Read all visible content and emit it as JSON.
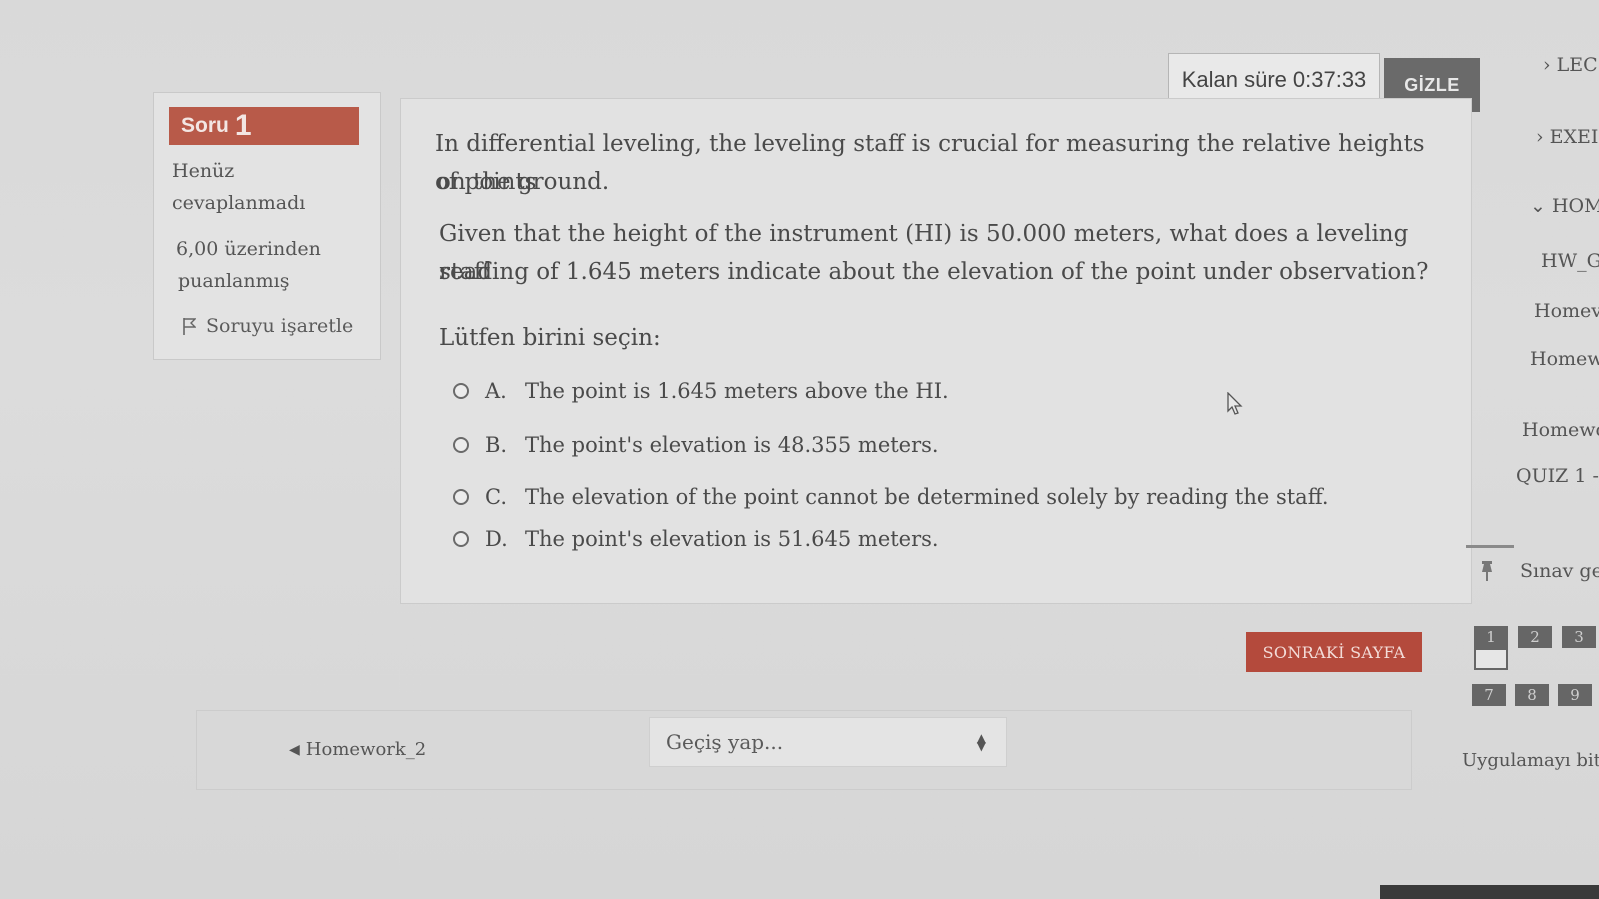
{
  "timer": {
    "label": "Kalan süre",
    "value": "0:37:33",
    "hide_button": "GİZLE"
  },
  "question_info": {
    "soru_label": "Soru",
    "number": "1",
    "status_line1": "Henüz",
    "status_line2": "cevaplanmadı",
    "points_line1": "6,00 üzerinden",
    "points_line2": "puanlanmış",
    "flag_label": "Soruyu işaretle"
  },
  "question": {
    "paragraph1_line1": "In differential leveling, the leveling staff is crucial for measuring the relative heights of points",
    "paragraph1_line2": "on the ground.",
    "paragraph2_line1": "Given that the height of the instrument (HI) is 50.000 meters, what does a leveling staff",
    "paragraph2_line2": "reading of 1.645 meters indicate about the elevation of the point under observation?",
    "prompt": "Lütfen birini seçin:",
    "options": [
      {
        "letter": "A.",
        "text": "The point is 1.645 meters above the HI."
      },
      {
        "letter": "B.",
        "text": "The point's elevation is 48.355 meters."
      },
      {
        "letter": "C.",
        "text": "The elevation of the point cannot be determined solely by reading the staff."
      },
      {
        "letter": "D.",
        "text": "The point's elevation is 51.645 meters."
      }
    ]
  },
  "next_button": "SONRAKİ SAYFA",
  "bottom_nav": {
    "prev_link": "Homework_2",
    "jump_placeholder": "Geçiş yap..."
  },
  "sidebar": {
    "items": [
      {
        "text": "› LEC"
      },
      {
        "text": "› EXEI"
      },
      {
        "text": "⌄ HOMI"
      },
      {
        "text": "HW_G"
      },
      {
        "text": "Homev"
      },
      {
        "text": "Homew"
      },
      {
        "text": "Homewo"
      },
      {
        "text": "QUIZ 1 - I"
      }
    ],
    "exam_nav_title": "Sınav ge",
    "nav_numbers": [
      "1",
      "2",
      "3",
      "7",
      "8",
      "9"
    ],
    "finish_link": "Uygulamayı bit"
  },
  "colors": {
    "badge_red": "#b85a49",
    "next_button_red": "#b44a3c",
    "hide_button_gray": "#6a6a6a"
  }
}
